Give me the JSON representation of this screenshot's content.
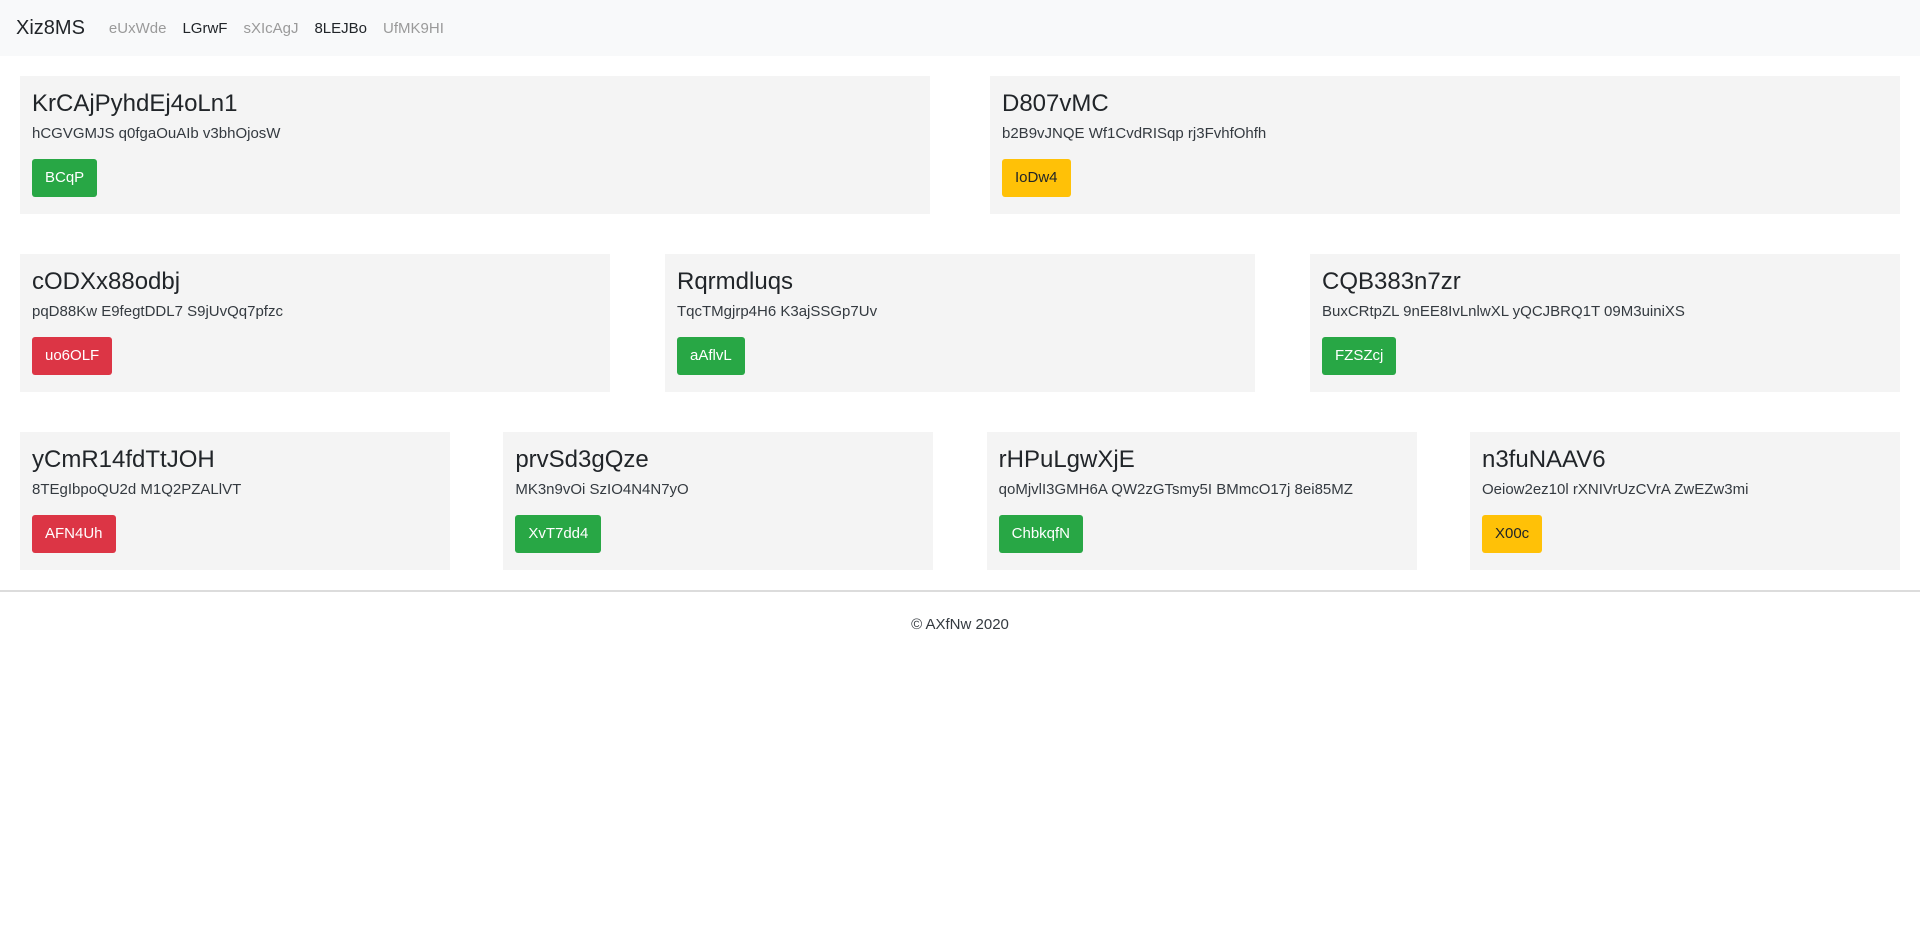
{
  "navbar": {
    "brand": "Xiz8MS",
    "links": [
      "eUxWde",
      "LGrwF",
      "sXIcAgJ",
      "8LEJBo",
      "UfMK9HI"
    ]
  },
  "row1": [
    {
      "title": "KrCAjPyhdEj4oLn1",
      "text": "hCGVGMJS q0fgaOuAIb v3bhOjosW",
      "button": "BCqP",
      "button_variant": "success"
    },
    {
      "title": "D807vMC",
      "text": "b2B9vJNQE Wf1CvdRISqp rj3FvhfOhfh",
      "button": "IoDw4",
      "button_variant": "warning"
    }
  ],
  "row2": [
    {
      "title": "cODXx88odbj",
      "text": "pqD88Kw E9fegtDDL7 S9jUvQq7pfzc",
      "button": "uo6OLF",
      "button_variant": "danger"
    },
    {
      "title": "Rqrmdluqs",
      "text": "TqcTMgjrp4H6 K3ajSSGp7Uv",
      "button": "aAflvL",
      "button_variant": "success"
    },
    {
      "title": "CQB383n7zr",
      "text": "BuxCRtpZL 9nEE8IvLnlwXL yQCJBRQ1T 09M3uiniXS",
      "button": "FZSZcj",
      "button_variant": "success"
    }
  ],
  "row3": [
    {
      "title": "yCmR14fdTtJOH",
      "text": "8TEgIbpoQU2d M1Q2PZALlVT",
      "button": "AFN4Uh",
      "button_variant": "danger"
    },
    {
      "title": "prvSd3gQze",
      "text": "MK3n9vOi SzIO4N4N7yO",
      "button": "XvT7dd4",
      "button_variant": "success"
    },
    {
      "title": "rHPuLgwXjE",
      "text": "qoMjvlI3GMH6A QW2zGTsmy5I BMmcO17j 8ei85MZ",
      "button": "ChbkqfN",
      "button_variant": "success"
    },
    {
      "title": "n3fuNAAV6",
      "text": "Oeiow2ez10l rXNIVrUzCVrA ZwEZw3mi",
      "button": "X00c",
      "button_variant": "warning"
    }
  ],
  "footer": {
    "text": "© AXfNw 2020"
  },
  "colors": {
    "success": "#28a745",
    "warning": "#ffc107",
    "danger": "#dc3545",
    "card_bg": "#f4f4f4",
    "navbar_bg": "#f8f9fa"
  }
}
